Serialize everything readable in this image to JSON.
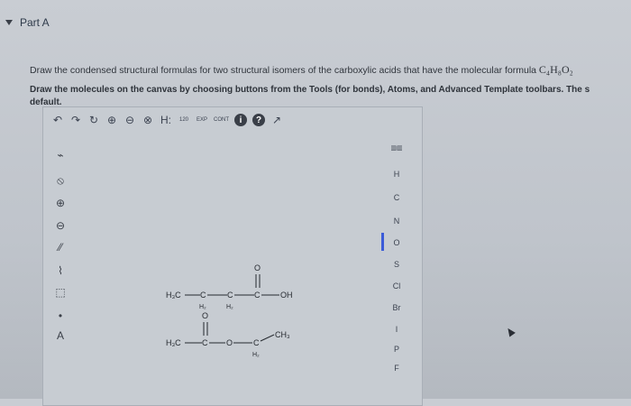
{
  "part": {
    "title": "Part A"
  },
  "question": {
    "line1": "Draw the condensed structural formulas for two structural isomers of the carboxylic acids that have the molecular formula ",
    "formula": "C₄H₈O₂",
    "line2": "Draw the molecules on the canvas by choosing buttons from the Tools (for bonds), Atoms, and Advanced Template toolbars. The s",
    "line3": "default."
  },
  "toolbar": {
    "tools": [
      "undo-icon",
      "redo-icon",
      "reset-icon",
      "zoom-in-icon",
      "zoom-out-icon",
      "clear-icon",
      "hydrogen-toggle",
      "numbering",
      "exp",
      "cont",
      "info-icon",
      "help-icon",
      "expand-icon"
    ],
    "labels": {
      "undo": "↶",
      "redo": "↷",
      "reset": "↻",
      "zoomin": "⊕",
      "zoomout": "⊖",
      "clear": "⊗",
      "h": "H:",
      "num": "120",
      "exp": "EXP",
      "cont": "CONT",
      "info": "i",
      "help": "?",
      "expand": "↗"
    }
  },
  "left_tools": [
    {
      "label": "⌁"
    },
    {
      "label": "⦸"
    },
    {
      "label": "⊕"
    },
    {
      "label": "⊖"
    },
    {
      "label": "⁄⁄"
    },
    {
      "label": "⌇"
    },
    {
      "label": "⬚"
    },
    {
      "label": "•"
    },
    {
      "label": "A"
    }
  ],
  "atoms": [
    "H",
    "C",
    "N",
    "O",
    "S",
    "Cl",
    "Br",
    "I",
    "P",
    "F"
  ],
  "atoms_selected": "O",
  "molecules": {
    "mol1": {
      "l": "H₃C",
      "a": "C",
      "b": "C",
      "c": "C",
      "h2a": "H₂",
      "h2b": "H₂",
      "oh": "OH",
      "o": "O"
    },
    "mol2": {
      "l": "H₃C",
      "a": "C",
      "b": "O",
      "c": "C",
      "d": "CH₃",
      "h2": "H₂",
      "o": "O"
    }
  }
}
